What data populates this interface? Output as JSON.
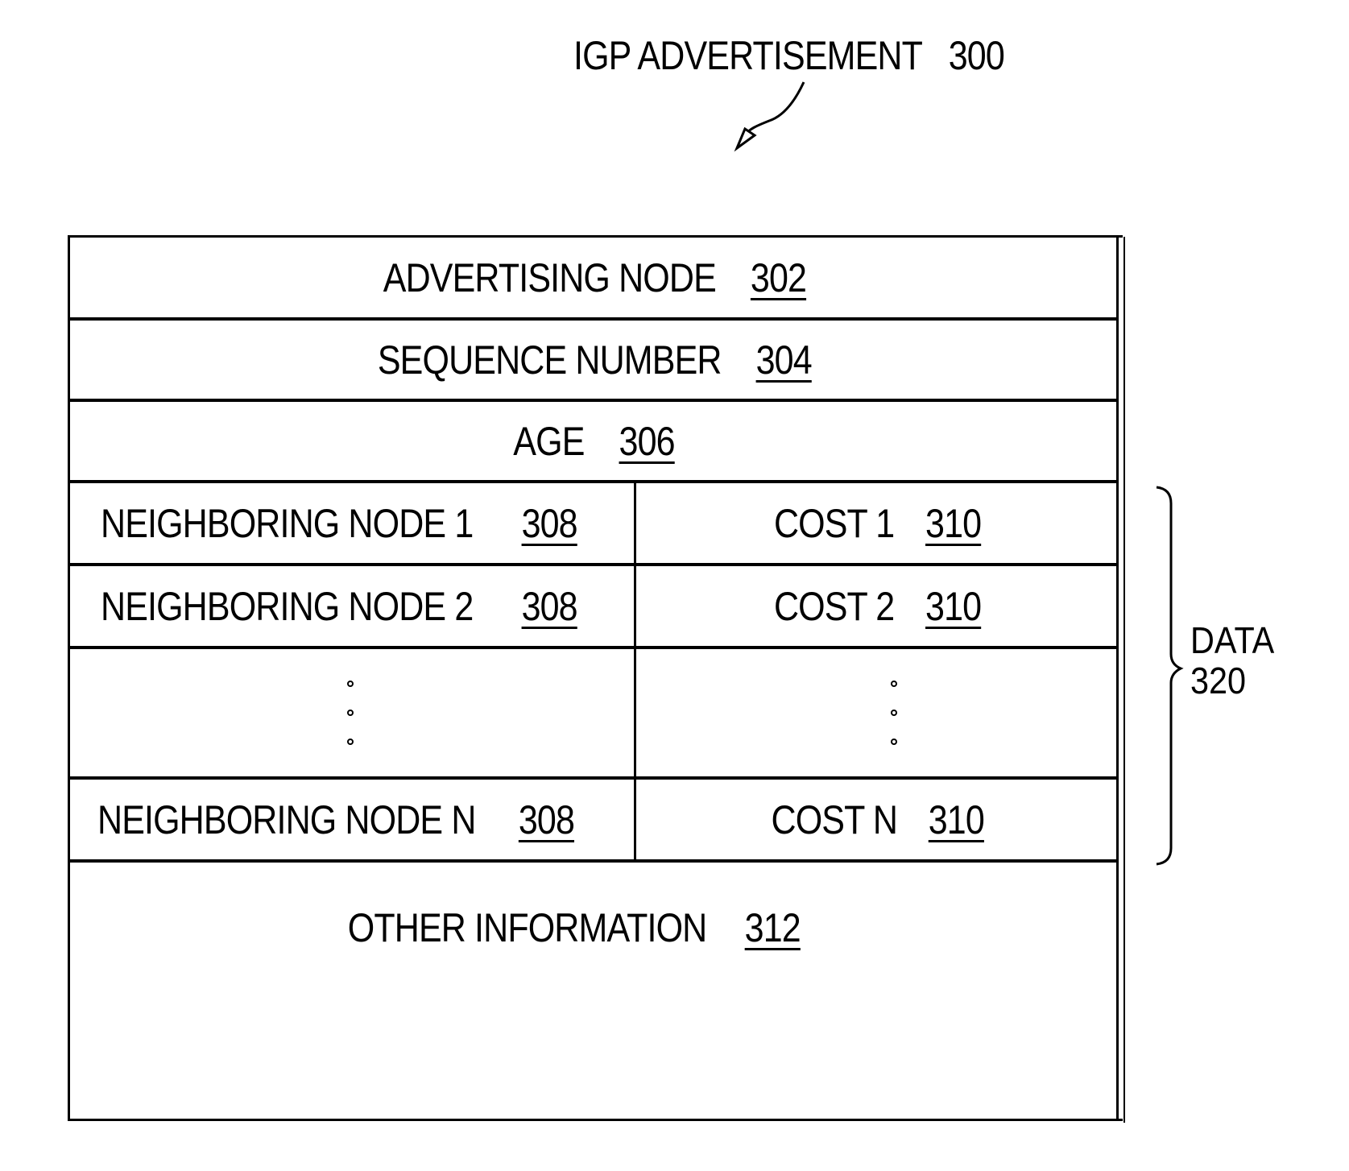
{
  "figure": {
    "title": "IGP ADVERTISEMENT",
    "title_ref": "300"
  },
  "fields": {
    "advertising_node": {
      "label": "ADVERTISING NODE",
      "ref": "302"
    },
    "sequence_number": {
      "label": "SEQUENCE NUMBER",
      "ref": "304"
    },
    "age": {
      "label": "AGE",
      "ref": "306"
    },
    "neighbors": [
      {
        "node_label": "NEIGHBORING NODE 1",
        "node_ref": "308",
        "cost_label": "COST 1",
        "cost_ref": "310"
      },
      {
        "node_label": "NEIGHBORING NODE 2",
        "node_ref": "308",
        "cost_label": "COST 2",
        "cost_ref": "310"
      },
      {
        "node_label": "NEIGHBORING NODE N",
        "node_ref": "308",
        "cost_label": "COST N",
        "cost_ref": "310"
      }
    ],
    "other_information": {
      "label": "OTHER INFORMATION",
      "ref": "312"
    }
  },
  "brace": {
    "label": "DATA",
    "ref": "320"
  }
}
